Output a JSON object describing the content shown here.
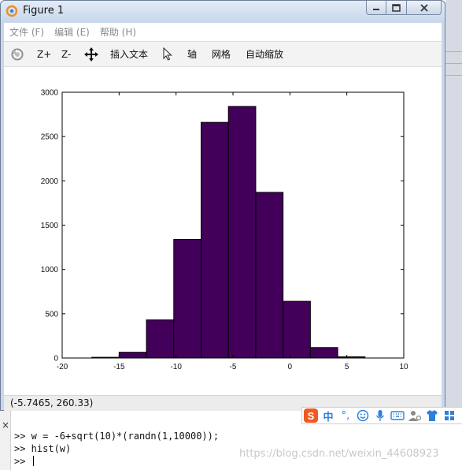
{
  "window": {
    "title": "Figure 1",
    "controls": [
      "minimize",
      "maximize",
      "close"
    ]
  },
  "menu": {
    "items": [
      {
        "label": "文件 (F)"
      },
      {
        "label": "编辑 (E)"
      },
      {
        "label": "帮助 (H)"
      }
    ]
  },
  "toolbar": {
    "rotate_icon": "rotate-icon",
    "zoom_in_label": "Z+",
    "zoom_out_label": "Z-",
    "pan_icon": "pan-icon",
    "insert_text_label": "插入文本",
    "select_icon": "pointer-icon",
    "axis_label": "轴",
    "grid_label": "网格",
    "autoscale_label": "自动缩放"
  },
  "status": {
    "coords": "(-5.7465, 260.33)"
  },
  "command_window": {
    "close_glyph": "×",
    "lines": [
      ">> w = -6+sqrt(10)*(randn(1,10000));",
      ">> hist(w)",
      ">> "
    ]
  },
  "ime_bar": {
    "logo": "S",
    "lang": "中",
    "punct": "°,",
    "icons": [
      "emoji-icon",
      "microphone-icon",
      "keyboard-icon",
      "user-settings-icon",
      "shirt-icon",
      "grid-apps-icon"
    ]
  },
  "watermark": "https://blog.csdn.net/weixin_44608923",
  "colors": {
    "bar_fill": "#42005a",
    "bar_edge": "#000000",
    "ime_logo": "#f05a22",
    "ime_blue": "#2f7fd8"
  },
  "chart_data": {
    "type": "bar",
    "title": "",
    "xlabel": "",
    "ylabel": "",
    "xlim": [
      -20,
      10
    ],
    "ylim": [
      0,
      3000
    ],
    "xticks": [
      -20,
      -15,
      -10,
      -5,
      0,
      5,
      10
    ],
    "yticks": [
      0,
      500,
      1000,
      1500,
      2000,
      2500,
      3000
    ],
    "grid": false,
    "legend": false,
    "bin_width": 2.4,
    "centers": [
      -16.2,
      -13.8,
      -11.4,
      -9.0,
      -6.6,
      -4.2,
      -1.8,
      0.6,
      3.0,
      5.4
    ],
    "values": [
      8,
      65,
      430,
      1340,
      2660,
      2840,
      1870,
      640,
      118,
      14
    ]
  }
}
